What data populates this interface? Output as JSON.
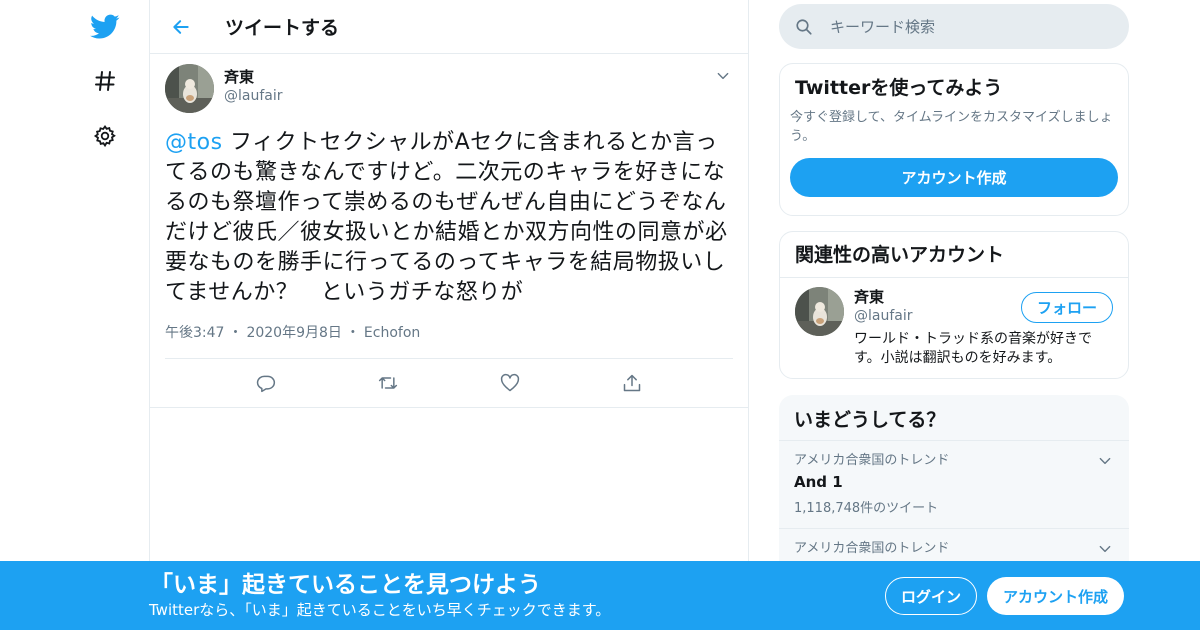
{
  "app": {
    "brand_color": "#1da1f2"
  },
  "nav": {
    "icons": [
      "twitter-bird-icon",
      "explore-hash-icon",
      "settings-gear-icon"
    ]
  },
  "header": {
    "title": "ツイートする"
  },
  "tweet": {
    "author_name": "斉東",
    "author_handle": "@laufair",
    "mention": "@tos",
    "body": " フィクトセクシャルがAセクに含まれるとか言ってるのも驚きなんですけど。二次元のキャラを好きになるのも祭壇作って崇めるのもぜんぜん自由にどうぞなんだけど彼氏／彼女扱いとか結婚とか双方向性の同意が必要なものを勝手に行ってるのってキャラを結局物扱いしてませんか？　というガチな怒りが",
    "time": "午後3:47",
    "date": "2020年9月8日",
    "source": "Echofon",
    "separator": "・"
  },
  "search": {
    "placeholder": "キーワード検索"
  },
  "signup_card": {
    "title": "Twitterを使ってみよう",
    "description": "今すぐ登録して、タイムラインをカスタマイズしましょう。",
    "button": "アカウント作成"
  },
  "related": {
    "title": "関連性の高いアカウント",
    "user_name": "斉東",
    "user_handle": "@laufair",
    "bio": "ワールド・トラッド系の音楽が好きです。小説は翻訳ものを好みます。",
    "follow_button": "フォロー"
  },
  "trends": {
    "title": "いまどうしてる？",
    "items": [
      {
        "context": "アメリカ合衆国のトレンド",
        "name": "And 1",
        "count": "1,118,748件のツイート"
      },
      {
        "context": "アメリカ合衆国のトレンド"
      }
    ]
  },
  "banner": {
    "title": "「いま」起きていることを見つけよう",
    "subtitle": "Twitterなら、「いま」起きていることをいち早くチェックできます。",
    "login_button": "ログイン",
    "signup_button": "アカウント作成"
  }
}
